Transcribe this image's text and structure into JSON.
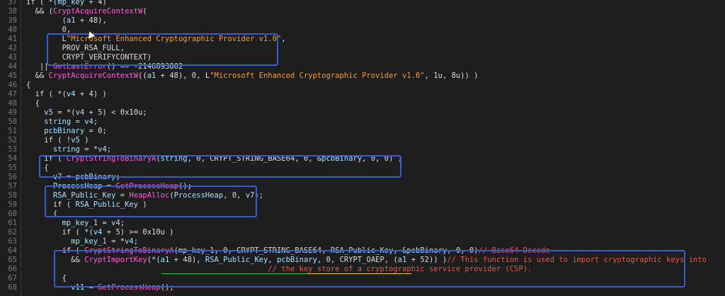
{
  "editor": {
    "lines": [
      {
        "num": "37",
        "tokens": [
          {
            "t": "if ( *(",
            "c": "plain"
          },
          {
            "t": "mp_key",
            "c": "var"
          },
          {
            "t": " + 4)",
            "c": "plain"
          }
        ]
      },
      {
        "num": "38",
        "tokens": [
          {
            "t": "  && (",
            "c": "plain"
          },
          {
            "t": "CryptAcquireContextW",
            "c": "func"
          },
          {
            "t": "(",
            "c": "plain"
          }
        ]
      },
      {
        "num": "39",
        "tokens": [
          {
            "t": "        (",
            "c": "plain"
          },
          {
            "t": "a1",
            "c": "var"
          },
          {
            "t": " + 48),",
            "c": "plain"
          }
        ]
      },
      {
        "num": "40",
        "tokens": [
          {
            "t": "        0,",
            "c": "plain"
          }
        ]
      },
      {
        "num": "41",
        "tokens": [
          {
            "t": "        L",
            "c": "plain"
          },
          {
            "t": "\"Microsoft Enhanced Cryptographic Provider v1.0\"",
            "c": "str"
          },
          {
            "t": ",",
            "c": "plain"
          }
        ]
      },
      {
        "num": "42",
        "tokens": [
          {
            "t": "        PROV_RSA_FULL,",
            "c": "plain"
          }
        ]
      },
      {
        "num": "43",
        "tokens": [
          {
            "t": "        CRYPT_VERIFYCONTEXT)",
            "c": "plain"
          }
        ]
      },
      {
        "num": "44",
        "tokens": [
          {
            "t": "   || ",
            "c": "plain"
          },
          {
            "t": "GetLastError",
            "c": "func"
          },
          {
            "t": "() == -2146893802",
            "c": "plain"
          }
        ]
      },
      {
        "num": "45",
        "tokens": [
          {
            "t": "  && ",
            "c": "plain"
          },
          {
            "t": "CryptAcquireContextW",
            "c": "func"
          },
          {
            "t": "((",
            "c": "plain"
          },
          {
            "t": "a1",
            "c": "var"
          },
          {
            "t": " + 48), 0, L",
            "c": "plain"
          },
          {
            "t": "\"Microsoft Enhanced Cryptographic Provider v1.0\"",
            "c": "str"
          },
          {
            "t": ", 1u, 8u)) )",
            "c": "plain"
          }
        ]
      },
      {
        "num": "46",
        "tokens": [
          {
            "t": "{",
            "c": "plain"
          }
        ]
      },
      {
        "num": "47",
        "tokens": [
          {
            "t": "  if ( *(",
            "c": "plain"
          },
          {
            "t": "v4",
            "c": "var"
          },
          {
            "t": " + 4) )",
            "c": "plain"
          }
        ]
      },
      {
        "num": "48",
        "tokens": [
          {
            "t": "  {",
            "c": "plain"
          }
        ]
      },
      {
        "num": "49",
        "tokens": [
          {
            "t": "    ",
            "c": "plain"
          },
          {
            "t": "v5",
            "c": "var"
          },
          {
            "t": " = *(",
            "c": "plain"
          },
          {
            "t": "v4",
            "c": "var"
          },
          {
            "t": " + 5) < 0x10u;",
            "c": "plain"
          }
        ]
      },
      {
        "num": "50",
        "tokens": [
          {
            "t": "    ",
            "c": "plain"
          },
          {
            "t": "string",
            "c": "var"
          },
          {
            "t": " = ",
            "c": "plain"
          },
          {
            "t": "v4",
            "c": "var"
          },
          {
            "t": ";",
            "c": "plain"
          }
        ]
      },
      {
        "num": "51",
        "tokens": [
          {
            "t": "    ",
            "c": "plain"
          },
          {
            "t": "pcbBinary",
            "c": "var"
          },
          {
            "t": " = 0;",
            "c": "plain"
          }
        ]
      },
      {
        "num": "52",
        "tokens": [
          {
            "t": "    if ( !",
            "c": "plain"
          },
          {
            "t": "v5",
            "c": "var"
          },
          {
            "t": " )",
            "c": "plain"
          }
        ]
      },
      {
        "num": "53",
        "tokens": [
          {
            "t": "      ",
            "c": "plain"
          },
          {
            "t": "string",
            "c": "var"
          },
          {
            "t": " = *",
            "c": "plain"
          },
          {
            "t": "v4",
            "c": "var"
          },
          {
            "t": ";",
            "c": "plain"
          }
        ]
      },
      {
        "num": "54",
        "tokens": [
          {
            "t": "    if ( ",
            "c": "plain"
          },
          {
            "t": "CryptStringToBinaryA",
            "c": "func"
          },
          {
            "t": "(",
            "c": "plain"
          },
          {
            "t": "string",
            "c": "var"
          },
          {
            "t": ", 0, CRYPT_STRING_BASE64, 0, &",
            "c": "plain"
          },
          {
            "t": "pcbBinary",
            "c": "var"
          },
          {
            "t": ", 0, 0) )",
            "c": "plain"
          }
        ]
      },
      {
        "num": "55",
        "tokens": [
          {
            "t": "    {",
            "c": "plain"
          }
        ]
      },
      {
        "num": "56",
        "tokens": [
          {
            "t": "      ",
            "c": "plain"
          },
          {
            "t": "v7",
            "c": "var"
          },
          {
            "t": " = ",
            "c": "plain"
          },
          {
            "t": "pcbBinary",
            "c": "var"
          },
          {
            "t": ";",
            "c": "plain"
          }
        ]
      },
      {
        "num": "57",
        "tokens": [
          {
            "t": "      ",
            "c": "plain"
          },
          {
            "t": "ProcessHeap",
            "c": "var"
          },
          {
            "t": " = ",
            "c": "plain"
          },
          {
            "t": "GetProcessHeap",
            "c": "func"
          },
          {
            "t": "();",
            "c": "plain"
          }
        ]
      },
      {
        "num": "58",
        "tokens": [
          {
            "t": "      ",
            "c": "plain"
          },
          {
            "t": "RSA_Public_Key",
            "c": "var"
          },
          {
            "t": " = ",
            "c": "plain"
          },
          {
            "t": "HeapAlloc",
            "c": "func"
          },
          {
            "t": "(",
            "c": "plain"
          },
          {
            "t": "ProcessHeap",
            "c": "var"
          },
          {
            "t": ", 0, ",
            "c": "plain"
          },
          {
            "t": "v7",
            "c": "var"
          },
          {
            "t": ");",
            "c": "plain"
          }
        ]
      },
      {
        "num": "59",
        "tokens": [
          {
            "t": "      if ( ",
            "c": "plain"
          },
          {
            "t": "RSA_Public_Key",
            "c": "var"
          },
          {
            "t": " )",
            "c": "plain"
          }
        ]
      },
      {
        "num": "60",
        "tokens": [
          {
            "t": "      {",
            "c": "plain"
          }
        ]
      },
      {
        "num": "61",
        "tokens": [
          {
            "t": "        ",
            "c": "plain"
          },
          {
            "t": "mp_key_1",
            "c": "var"
          },
          {
            "t": " = ",
            "c": "plain"
          },
          {
            "t": "v4",
            "c": "var"
          },
          {
            "t": ";",
            "c": "plain"
          }
        ]
      },
      {
        "num": "62",
        "tokens": [
          {
            "t": "        if ( *(",
            "c": "plain"
          },
          {
            "t": "v4",
            "c": "var"
          },
          {
            "t": " + 5) >= 0x10u )",
            "c": "plain"
          }
        ]
      },
      {
        "num": "63",
        "tokens": [
          {
            "t": "          ",
            "c": "plain"
          },
          {
            "t": "mp_key_1",
            "c": "var"
          },
          {
            "t": " = *",
            "c": "plain"
          },
          {
            "t": "v4",
            "c": "var"
          },
          {
            "t": ";",
            "c": "plain"
          }
        ]
      },
      {
        "num": "64",
        "tokens": [
          {
            "t": "        if ( ",
            "c": "plain"
          },
          {
            "t": "CryptStringToBinaryA",
            "c": "func"
          },
          {
            "t": "(",
            "c": "plain"
          },
          {
            "t": "mp_key_1",
            "c": "var"
          },
          {
            "t": ", 0, CRYPT_STRING_BASE64, ",
            "c": "plain"
          },
          {
            "t": "RSA_Public_Key",
            "c": "var"
          },
          {
            "t": ", &",
            "c": "plain"
          },
          {
            "t": "pcbBinary",
            "c": "var"
          },
          {
            "t": ", 0, 0)",
            "c": "plain"
          },
          {
            "t": "// Base64 Decode",
            "c": "comment"
          }
        ]
      },
      {
        "num": "65",
        "tokens": [
          {
            "t": "          && ",
            "c": "plain"
          },
          {
            "t": "CryptImportKey",
            "c": "func"
          },
          {
            "t": "(*(",
            "c": "plain"
          },
          {
            "t": "a1",
            "c": "var"
          },
          {
            "t": " + 48), ",
            "c": "plain"
          },
          {
            "t": "RSA_Public_Key",
            "c": "var"
          },
          {
            "t": ", ",
            "c": "plain"
          },
          {
            "t": "pcbBinary",
            "c": "var"
          },
          {
            "t": ", 0, CRYPT_OAEP, (",
            "c": "plain"
          },
          {
            "t": "a1",
            "c": "var"
          },
          {
            "t": " + 52)) )",
            "c": "plain"
          },
          {
            "t": "// This function is used to import cryptographic keys into",
            "c": "comment"
          }
        ]
      },
      {
        "num": "66",
        "tokens": [
          {
            "t": "                                                      ",
            "c": "plain"
          },
          {
            "t": "// the key store of a cryptographic service provider (CSP).",
            "c": "comment"
          }
        ]
      },
      {
        "num": "67",
        "tokens": [
          {
            "t": "        {",
            "c": "plain"
          }
        ]
      },
      {
        "num": "68",
        "tokens": [
          {
            "t": "          ",
            "c": "plain"
          },
          {
            "t": "v11",
            "c": "var"
          },
          {
            "t": " = ",
            "c": "plain"
          },
          {
            "t": "GetProcessHeap",
            "c": "func"
          },
          {
            "t": "();",
            "c": "plain"
          }
        ]
      }
    ]
  },
  "colors": {
    "background": "#1e1e1e",
    "variable": "#a6e0ff",
    "function": "#ff5cd6",
    "string": "#f59e2e",
    "comment": "#e05a4a",
    "highlight_box": "#3a5ad4",
    "underline_green": "#22c55e",
    "underline_yellow": "#e5d021"
  },
  "icons": {
    "cursor": "mouse-pointer-icon"
  }
}
